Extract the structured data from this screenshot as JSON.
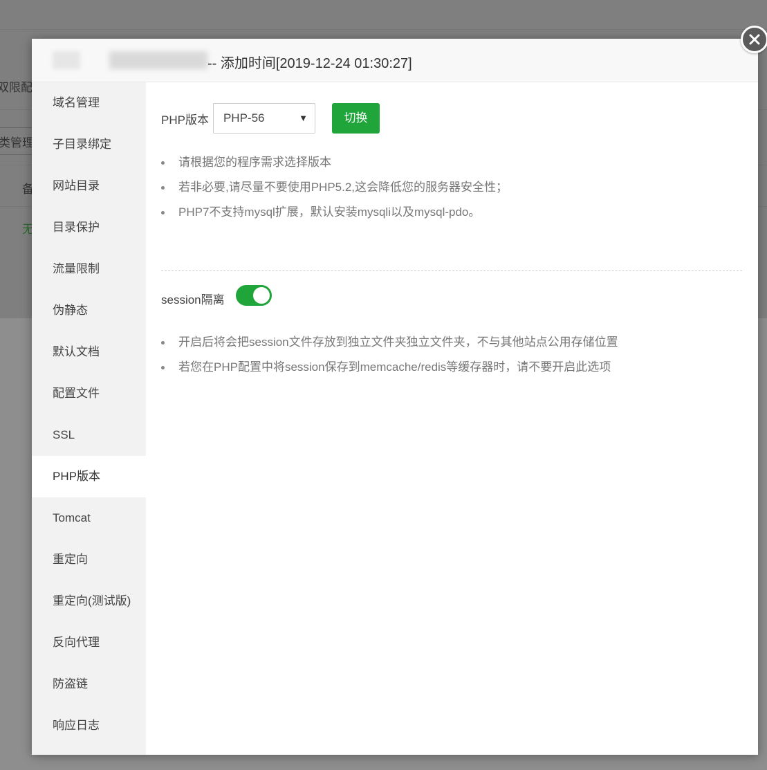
{
  "background": {
    "fragments": [
      "双限配",
      "类管理",
      "备",
      "无"
    ]
  },
  "modal": {
    "title": "-- 添加时间[2019-12-24 01:30:27]",
    "close_icon": "close-icon"
  },
  "sidebar": {
    "items": [
      {
        "label": "域名管理"
      },
      {
        "label": "子目录绑定"
      },
      {
        "label": "网站目录"
      },
      {
        "label": "目录保护"
      },
      {
        "label": "流量限制"
      },
      {
        "label": "伪静态"
      },
      {
        "label": "默认文档"
      },
      {
        "label": "配置文件"
      },
      {
        "label": "SSL"
      },
      {
        "label": "PHP版本",
        "active": true
      },
      {
        "label": "Tomcat"
      },
      {
        "label": "重定向"
      },
      {
        "label": "重定向(测试版)"
      },
      {
        "label": "反向代理"
      },
      {
        "label": "防盗链"
      },
      {
        "label": "响应日志"
      }
    ]
  },
  "php": {
    "label": "PHP版本",
    "selected": "PHP-56",
    "switch_label": "切换",
    "tips": [
      "请根据您的程序需求选择版本",
      "若非必要,请尽量不要使用PHP5.2,这会降低您的服务器安全性；",
      "PHP7不支持mysql扩展，默认安装mysqli以及mysql-pdo。"
    ]
  },
  "session": {
    "label": "session隔离",
    "enabled": true,
    "tips": [
      "开启后将会把session文件存放到独立文件夹独立文件夹，不与其他站点公用存储位置",
      "若您在PHP配置中将session保存到memcache/redis等缓存器时，请不要开启此选项"
    ]
  },
  "colors": {
    "accent": "#20a53a",
    "sidebar_bg": "#f2f2f2",
    "header_bg": "#f8f8f8"
  }
}
